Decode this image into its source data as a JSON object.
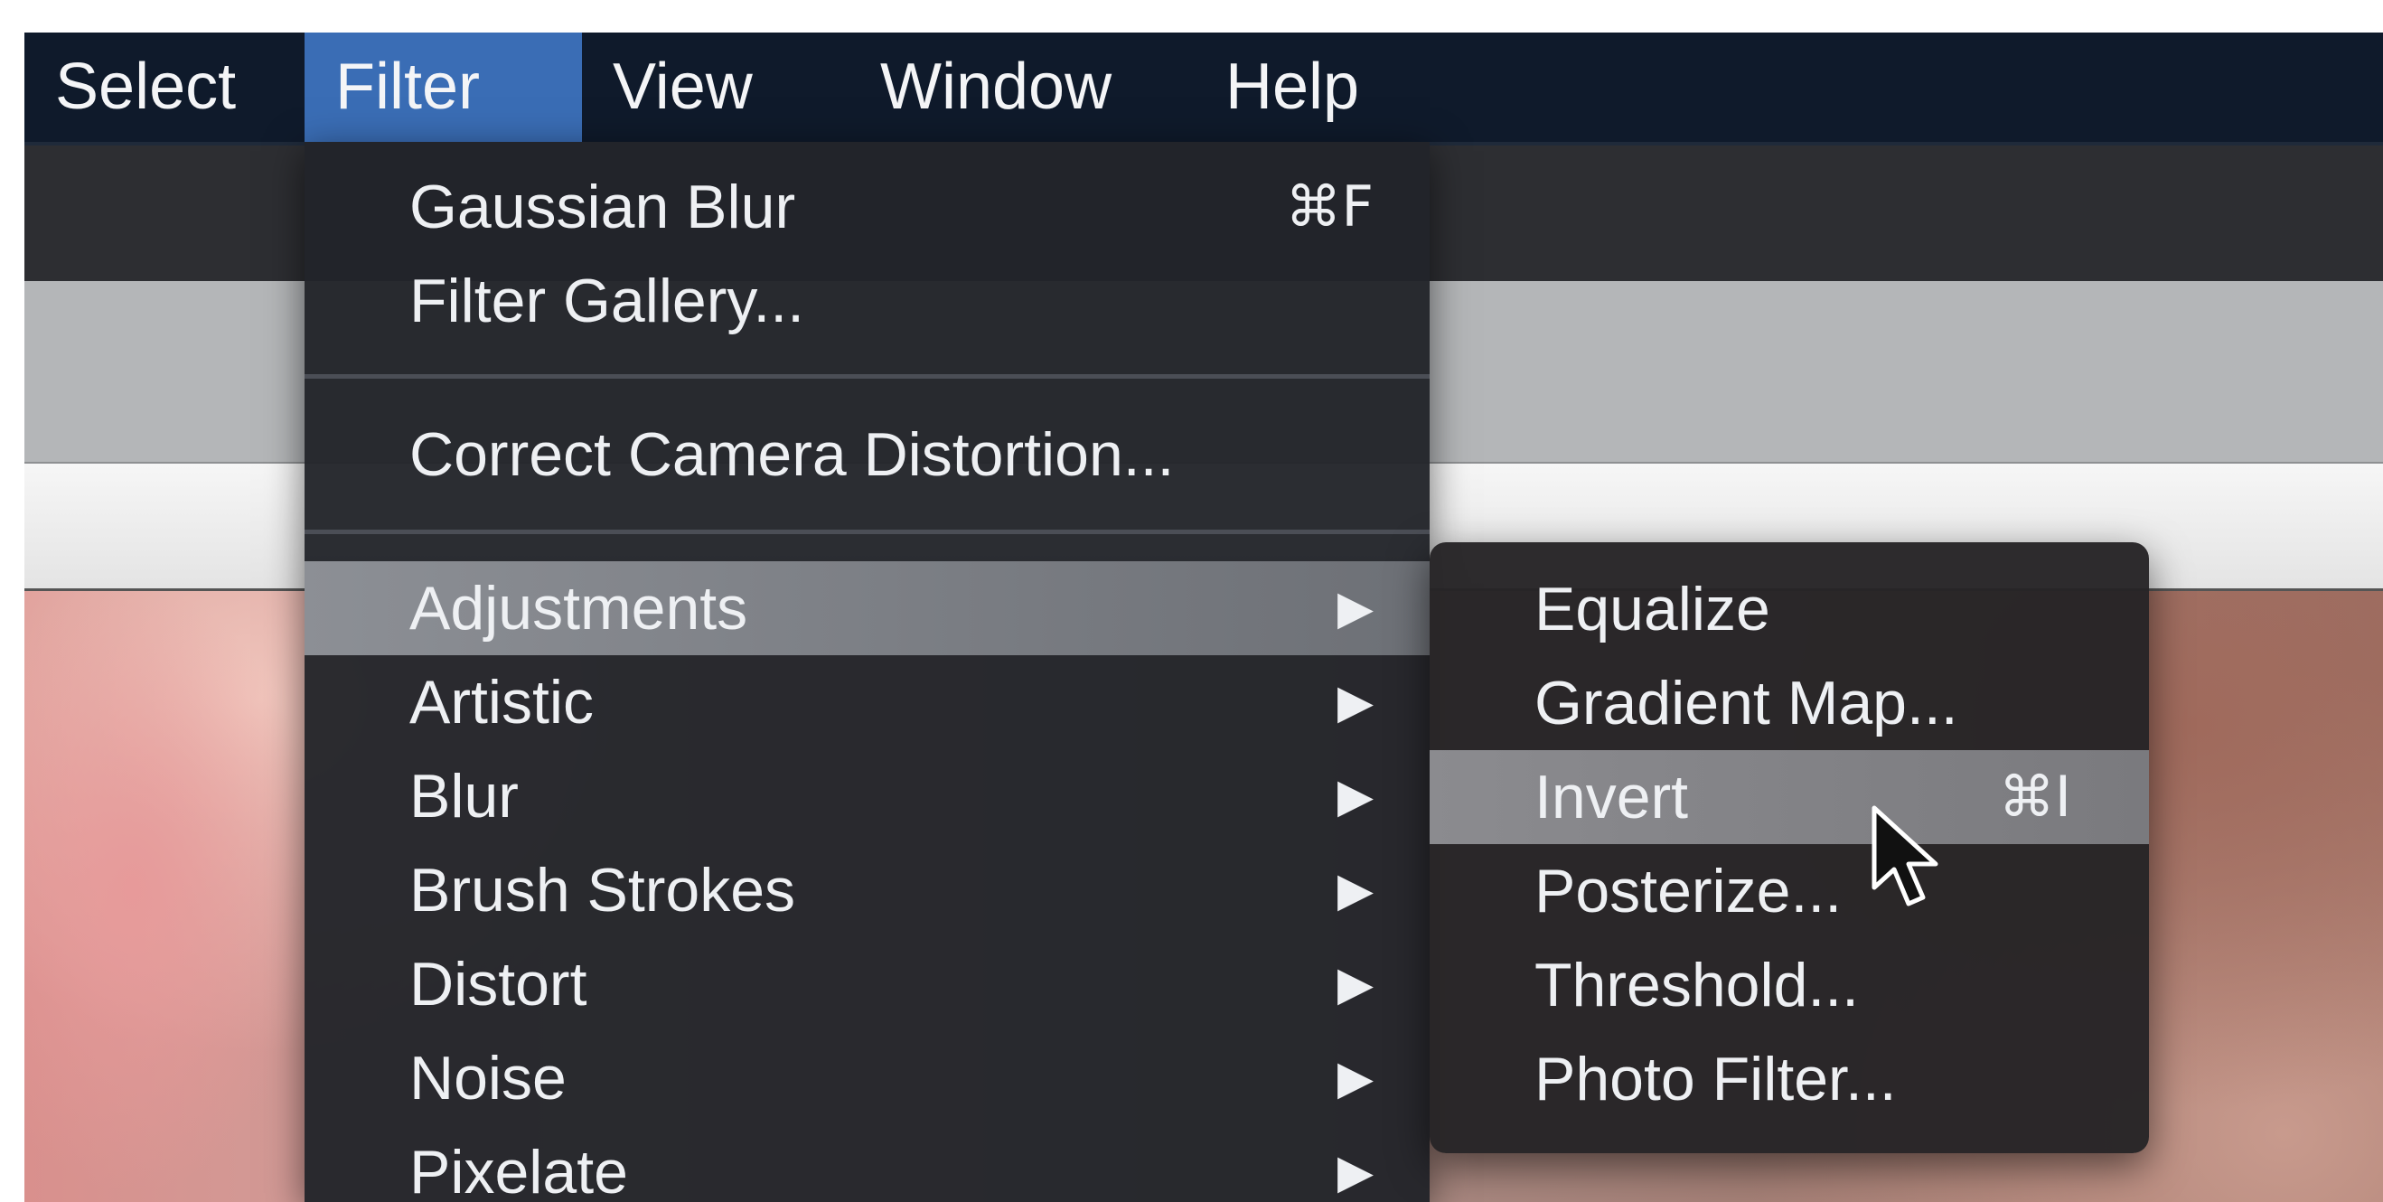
{
  "menubar": {
    "items": [
      {
        "label": "Select"
      },
      {
        "label": "Filter",
        "active": true
      },
      {
        "label": "View"
      },
      {
        "label": "Window"
      },
      {
        "label": "Help"
      }
    ]
  },
  "filter_menu": {
    "top_items": [
      {
        "label": "Gaussian Blur",
        "shortcut": "⌘F"
      },
      {
        "label": "Filter Gallery..."
      }
    ],
    "middle_items": [
      {
        "label": "Correct Camera Distortion..."
      }
    ],
    "category_items": [
      {
        "label": "Adjustments",
        "arrow": "▶",
        "highlighted": true
      },
      {
        "label": "Artistic",
        "arrow": "▶"
      },
      {
        "label": "Blur",
        "arrow": "▶"
      },
      {
        "label": "Brush Strokes",
        "arrow": "▶"
      },
      {
        "label": "Distort",
        "arrow": "▶"
      },
      {
        "label": "Noise",
        "arrow": "▶"
      },
      {
        "label": "Pixelate",
        "arrow": "▶"
      }
    ]
  },
  "adjustments_submenu": {
    "items": [
      {
        "label": "Equalize"
      },
      {
        "label": "Gradient Map..."
      },
      {
        "label": "Invert",
        "shortcut": "⌘I",
        "highlighted": true
      },
      {
        "label": "Posterize..."
      },
      {
        "label": "Threshold..."
      },
      {
        "label": "Photo Filter..."
      }
    ]
  },
  "colors": {
    "menubar_bg": "#0f1a2b",
    "menubar_active": "#3a6db5",
    "menu_bg": "#22242a",
    "highlight": "#8c8f95"
  },
  "icons": {
    "submenu_arrow": "triangle-right-icon",
    "pointer": "mouse-pointer-icon"
  }
}
